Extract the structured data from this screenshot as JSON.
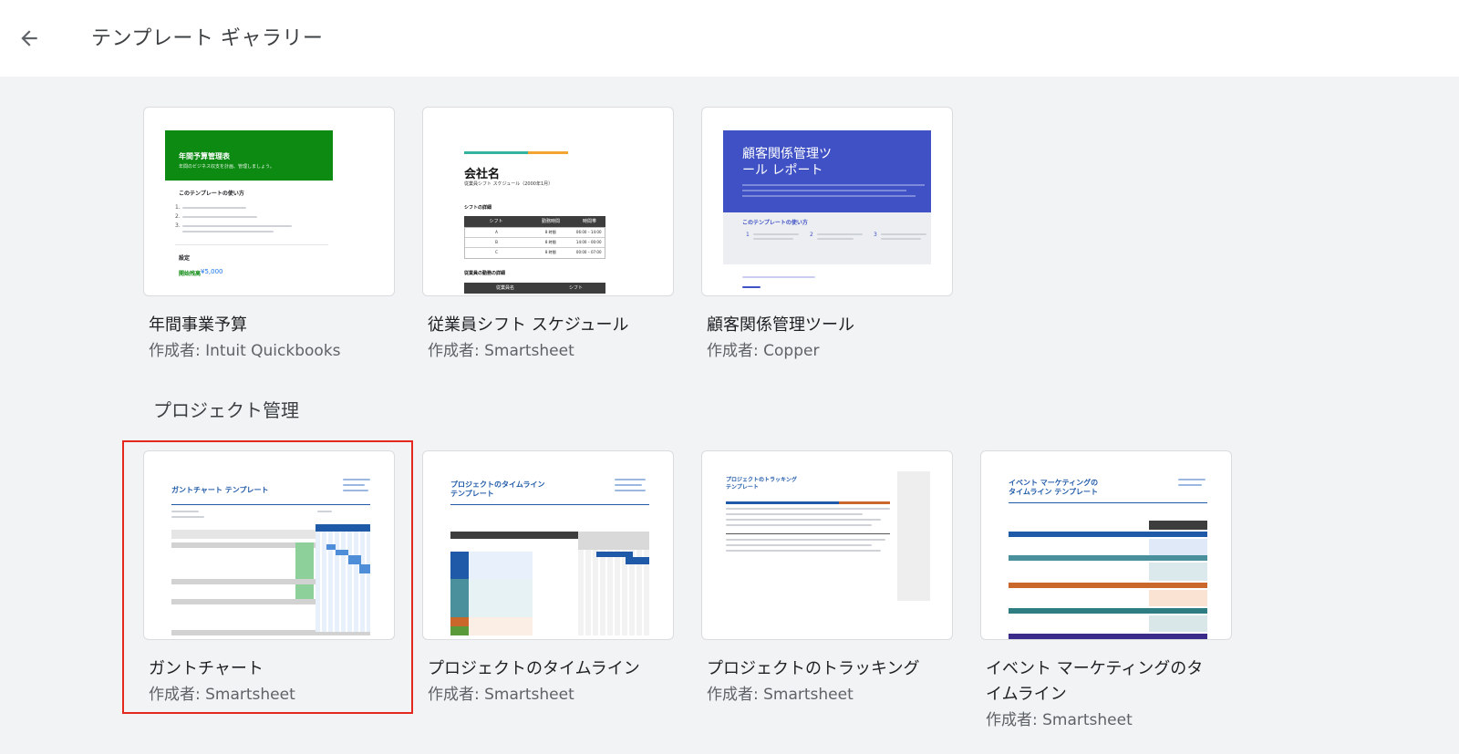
{
  "header": {
    "title": "テンプレート ギャラリー"
  },
  "colors": {
    "accent_green": "#0c8a12",
    "accent_blue": "#3f51c4",
    "selection_red": "#e5281e",
    "smartsheet_blue": "#1f5aa8"
  },
  "rows": [
    {
      "cards": [
        {
          "title": "年間事業予算",
          "author": "作成者: Intuit Quickbooks",
          "thumb": {
            "heading": "年間予算管理表",
            "subheading": "年間のビジネス収支を計画、管理しましょう。",
            "section": "このテンプレートの使い方",
            "steps": [
              "1.",
              "2.",
              "3."
            ],
            "label": "設定",
            "amount_label": "開始残高",
            "amount": "¥5,000"
          }
        },
        {
          "title": "従業員シフト スケジュール",
          "author": "作成者: Smartsheet",
          "thumb": {
            "company": "会社名",
            "subtitle": "従業員シフト スケジュール（2000年1月）",
            "table_title": "シフトの詳細",
            "columns": [
              "シフト",
              "勤務時間",
              "時間帯"
            ],
            "rows": [
              [
                "A",
                "8 時間",
                "06:00 – 14:00"
              ],
              [
                "B",
                "8 時間",
                "14:00 – 00:00"
              ],
              [
                "C",
                "8 時間",
                "00:00 – 07:00"
              ]
            ],
            "section2": "従業員の勤務の詳細",
            "columns2": [
              "従業員名",
              "シフト"
            ]
          }
        },
        {
          "title": "顧客関係管理ツール",
          "author": "作成者: Copper",
          "thumb": {
            "heading_line1": "顧客関係管理ツ",
            "heading_line2": "ール レポート",
            "section": "このテンプレートの使い方",
            "steps": [
              "1",
              "2",
              "3"
            ]
          }
        }
      ]
    }
  ],
  "section": {
    "title": "プロジェクト管理"
  },
  "project_cards": [
    {
      "title": "ガントチャート",
      "author": "作成者: Smartsheet",
      "thumb": {
        "heading": "ガントチャート テンプレート"
      }
    },
    {
      "title": "プロジェクトのタイムライン",
      "author": "作成者: Smartsheet",
      "thumb": {
        "heading_line1": "プロジェクトのタイムライン",
        "heading_line2": "テンプレート"
      }
    },
    {
      "title": "プロジェクトのトラッキング",
      "author": "作成者: Smartsheet",
      "thumb": {
        "heading_line1": "プロジェクトのトラッキング",
        "heading_line2": "テンプレート"
      }
    },
    {
      "title_line1": "イベント マーケティングのタ",
      "title_line2": "イムライン",
      "author": "作成者: Smartsheet",
      "thumb": {
        "heading_line1": "イベント マーケティングの",
        "heading_line2": "タイムライン テンプレート"
      }
    }
  ]
}
